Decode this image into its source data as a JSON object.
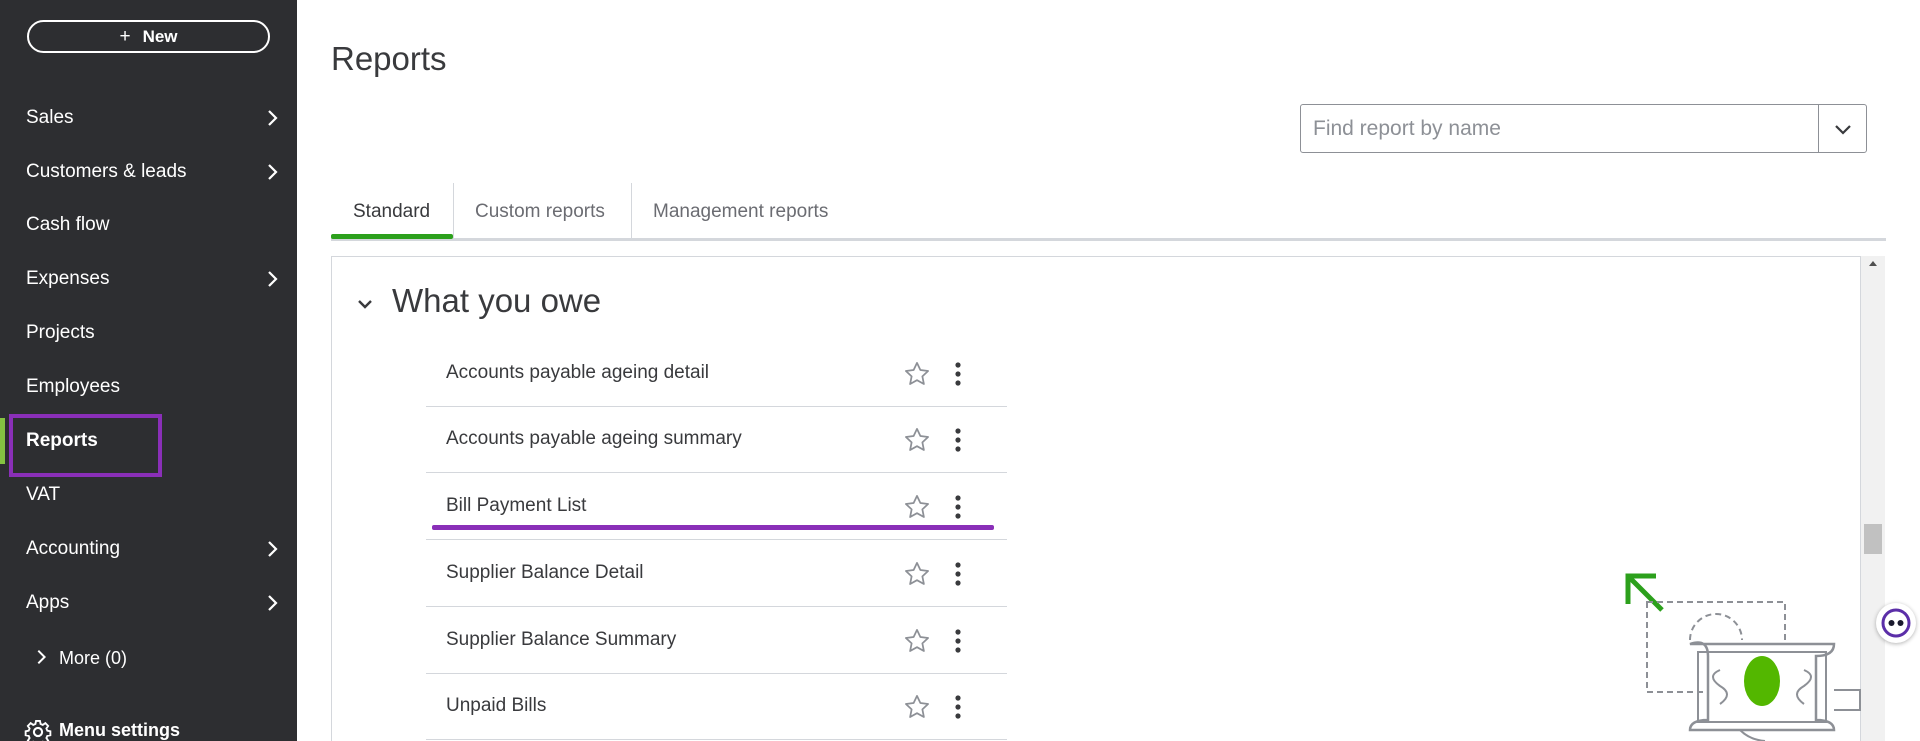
{
  "sidebar": {
    "new_label": "New",
    "items": [
      {
        "label": "Sales",
        "has_arrow": true
      },
      {
        "label": "Customers & leads",
        "has_arrow": true
      },
      {
        "label": "Cash flow",
        "has_arrow": false
      },
      {
        "label": "Expenses",
        "has_arrow": true
      },
      {
        "label": "Projects",
        "has_arrow": false
      },
      {
        "label": "Employees",
        "has_arrow": false
      },
      {
        "label": "Reports",
        "has_arrow": false,
        "active": true
      },
      {
        "label": "VAT",
        "has_arrow": false
      },
      {
        "label": "Accounting",
        "has_arrow": true
      },
      {
        "label": "Apps",
        "has_arrow": true
      }
    ],
    "more_label": "More (0)",
    "menu_settings_label": "Menu settings"
  },
  "main": {
    "title": "Reports",
    "search": {
      "placeholder": "Find report by name"
    },
    "tabs": [
      {
        "label": "Standard",
        "active": true
      },
      {
        "label": "Custom reports"
      },
      {
        "label": "Management reports"
      }
    ],
    "section": {
      "title": "What you owe",
      "reports": [
        "Accounts payable ageing detail",
        "Accounts payable ageing summary",
        "Bill Payment List",
        "Supplier Balance Detail",
        "Supplier Balance Summary",
        "Unpaid Bills"
      ]
    }
  },
  "colors": {
    "sidebar_bg": "#2d2e31",
    "active_indicator": "#84c341",
    "tab_active": "#2ca01c",
    "annotation": "#8a2fb8"
  },
  "icons": [
    "plus-icon",
    "chevron-right-icon",
    "gear-icon",
    "chevron-down-icon",
    "star-icon",
    "more-vertical-icon",
    "assistant-icon"
  ]
}
